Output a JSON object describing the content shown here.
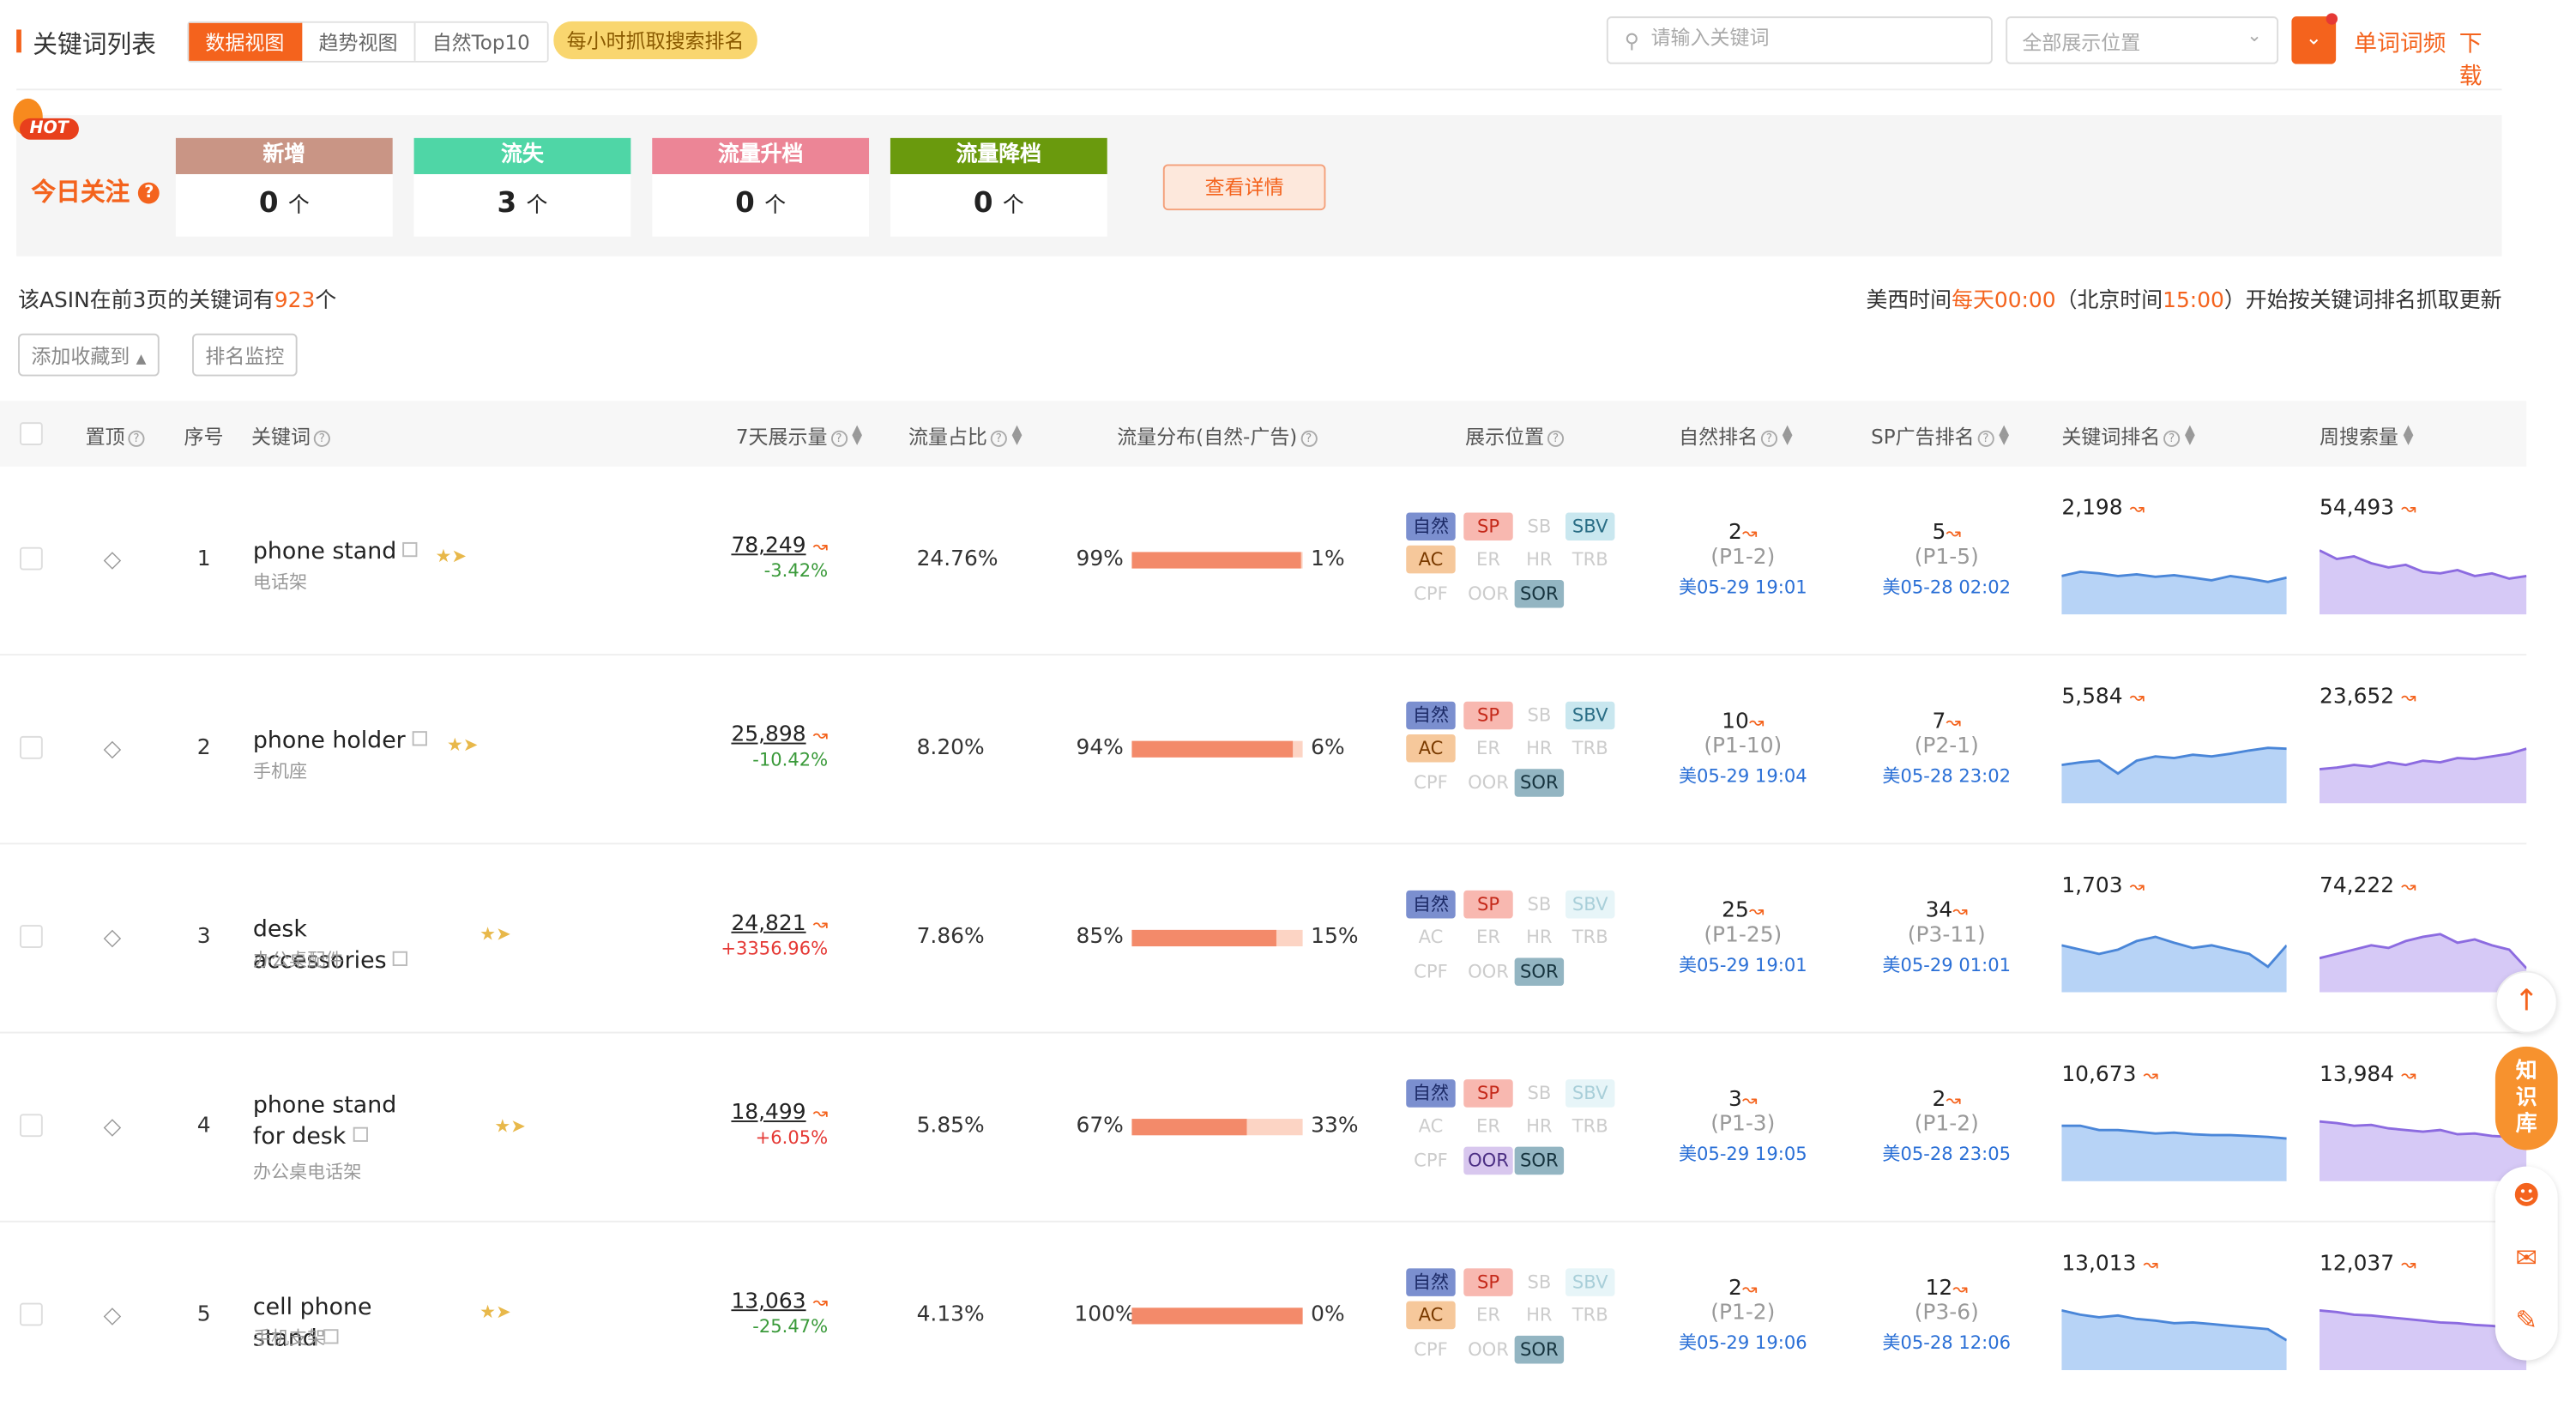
{
  "header": {
    "title": "关键词列表",
    "view_tabs": [
      "数据视图",
      "趋势视图",
      "自然Top10"
    ],
    "hourly_badge": "每小时抓取搜索排名",
    "search_placeholder": "请输入关键词",
    "position_select": "全部展示位置",
    "link_frequency": "单词词频",
    "link_download": "下载"
  },
  "today": {
    "hot": "HOT",
    "label": "今日关注",
    "stats": [
      {
        "label": "新增",
        "value": "0",
        "unit": "个",
        "color": "#c99585"
      },
      {
        "label": "流失",
        "value": "3",
        "unit": "个",
        "color": "#4fd6a6"
      },
      {
        "label": "流量升档",
        "value": "0",
        "unit": "个",
        "color": "#ec8596"
      },
      {
        "label": "流量降档",
        "value": "0",
        "unit": "个",
        "color": "#6a9a0d"
      }
    ],
    "detail_button": "查看详情"
  },
  "summary": {
    "prefix": "该ASIN在前3页的关键词有",
    "count": "923",
    "suffix": "个"
  },
  "update_note": {
    "p1": "美西时间",
    "t1": "每天00:00",
    "p2": "（北京时间",
    "t2": "15:00",
    "p3": "）开始按关键词排名抓取更新"
  },
  "actions": {
    "add_favorite": "添加收藏到",
    "rank_monitor": "排名监控"
  },
  "columns": [
    "置顶",
    "序号",
    "关键词",
    "7天展示量",
    "流量占比",
    "流量分布(自然-广告)",
    "展示位置",
    "自然排名",
    "SP广告排名",
    "关键词排名",
    "周搜索量"
  ],
  "position_chip_labels": [
    "自然",
    "SP",
    "SB",
    "SBV",
    "AC",
    "ER",
    "HR",
    "TRB",
    "CPF",
    "OOR",
    "SOR"
  ],
  "rows": [
    {
      "index": "1",
      "keyword": "phone stand",
      "keyword_cn": "电话架",
      "impressions": "78,249",
      "imp_change": "-3.42%",
      "imp_dir": "down",
      "share": "24.76%",
      "organic_pct": "99%",
      "ad_pct": "1%",
      "organic_frac": 0.99,
      "chips_on": [
        "自然",
        "SP",
        "SBV",
        "AC",
        "SOR"
      ],
      "organic_rank": "2",
      "organic_page": "(P1-2)",
      "organic_time": "美05-29 19:01",
      "sp_rank": "5",
      "sp_page": "(P1-5)",
      "sp_time": "美05-28 02:02",
      "kw_rank": "2,198",
      "kw_rank_series": [
        0.55,
        0.5,
        0.52,
        0.55,
        0.53,
        0.56,
        0.54,
        0.57,
        0.6,
        0.55,
        0.58,
        0.62,
        0.57
      ],
      "weekly": "54,493",
      "weekly_series": [
        0.25,
        0.35,
        0.32,
        0.4,
        0.45,
        0.42,
        0.5,
        0.52,
        0.48,
        0.55,
        0.52,
        0.58,
        0.55
      ]
    },
    {
      "index": "2",
      "keyword": "phone holder",
      "keyword_cn": "手机座",
      "impressions": "25,898",
      "imp_change": "-10.42%",
      "imp_dir": "down",
      "share": "8.20%",
      "organic_pct": "94%",
      "ad_pct": "6%",
      "organic_frac": 0.94,
      "chips_on": [
        "自然",
        "SP",
        "SBV",
        "AC",
        "SOR"
      ],
      "organic_rank": "10",
      "organic_page": "(P1-10)",
      "organic_time": "美05-29 19:04",
      "sp_rank": "7",
      "sp_page": "(P2-1)",
      "sp_time": "美05-28 23:02",
      "kw_rank": "5,584",
      "kw_rank_series": [
        0.55,
        0.52,
        0.5,
        0.65,
        0.5,
        0.45,
        0.47,
        0.43,
        0.45,
        0.42,
        0.38,
        0.35,
        0.36
      ],
      "weekly": "23,652",
      "weekly_series": [
        0.6,
        0.58,
        0.55,
        0.57,
        0.52,
        0.55,
        0.5,
        0.52,
        0.47,
        0.48,
        0.45,
        0.42,
        0.36
      ]
    },
    {
      "index": "3",
      "keyword": "desk accessories",
      "keyword_cn": "办公桌配件",
      "impressions": "24,821",
      "imp_change": "+3356.96%",
      "imp_dir": "up",
      "share": "7.86%",
      "organic_pct": "85%",
      "ad_pct": "15%",
      "organic_frac": 0.85,
      "chips_on": [
        "自然",
        "SP",
        "SOR"
      ],
      "organic_rank": "25",
      "organic_page": "(P1-25)",
      "organic_time": "美05-29 19:01",
      "sp_rank": "34",
      "sp_page": "(P3-11)",
      "sp_time": "美05-29 01:01",
      "kw_rank": "1,703",
      "kw_rank_series": [
        0.45,
        0.5,
        0.55,
        0.5,
        0.4,
        0.35,
        0.42,
        0.48,
        0.45,
        0.5,
        0.55,
        0.7,
        0.45
      ],
      "weekly": "74,222",
      "weekly_series": [
        0.6,
        0.55,
        0.5,
        0.45,
        0.48,
        0.4,
        0.35,
        0.32,
        0.42,
        0.38,
        0.45,
        0.5,
        0.72
      ]
    },
    {
      "index": "4",
      "keyword": "phone stand for desk",
      "keyword_cn": "办公桌电话架",
      "impressions": "18,499",
      "imp_change": "+6.05%",
      "imp_dir": "up",
      "share": "5.85%",
      "organic_pct": "67%",
      "ad_pct": "33%",
      "organic_frac": 0.67,
      "chips_on": [
        "自然",
        "SP",
        "OOR",
        "SOR"
      ],
      "organic_rank": "3",
      "organic_page": "(P1-3)",
      "organic_time": "美05-29 19:05",
      "sp_rank": "2",
      "sp_page": "(P1-2)",
      "sp_time": "美05-28 23:05",
      "kw_rank": "10,673",
      "kw_rank_series": [
        0.35,
        0.35,
        0.4,
        0.4,
        0.42,
        0.44,
        0.43,
        0.45,
        0.46,
        0.46,
        0.47,
        0.48,
        0.5
      ],
      "weekly": "13,984",
      "weekly_series": [
        0.3,
        0.32,
        0.35,
        0.34,
        0.38,
        0.4,
        0.42,
        0.4,
        0.45,
        0.44,
        0.47,
        0.48,
        0.5
      ]
    },
    {
      "index": "5",
      "keyword": "cell phone stand",
      "keyword_cn": "手机支架",
      "impressions": "13,063",
      "imp_change": "-25.47%",
      "imp_dir": "down",
      "share": "4.13%",
      "organic_pct": "100%",
      "ad_pct": "0%",
      "organic_frac": 1.0,
      "chips_on": [
        "自然",
        "SP",
        "AC",
        "SOR"
      ],
      "organic_rank": "2",
      "organic_page": "(P1-2)",
      "organic_time": "美05-29 19:06",
      "sp_rank": "12",
      "sp_page": "(P3-6)",
      "sp_time": "美05-28 12:06",
      "kw_rank": "13,013",
      "kw_rank_series": [
        0.3,
        0.35,
        0.38,
        0.36,
        0.4,
        0.42,
        0.45,
        0.44,
        0.46,
        0.48,
        0.5,
        0.52,
        0.65
      ],
      "weekly": "12,037",
      "weekly_series": [
        0.3,
        0.32,
        0.35,
        0.36,
        0.38,
        0.4,
        0.42,
        0.44,
        0.45,
        0.47,
        0.48,
        0.5,
        0.55
      ]
    }
  ],
  "float": {
    "knowledge": "知识库"
  }
}
